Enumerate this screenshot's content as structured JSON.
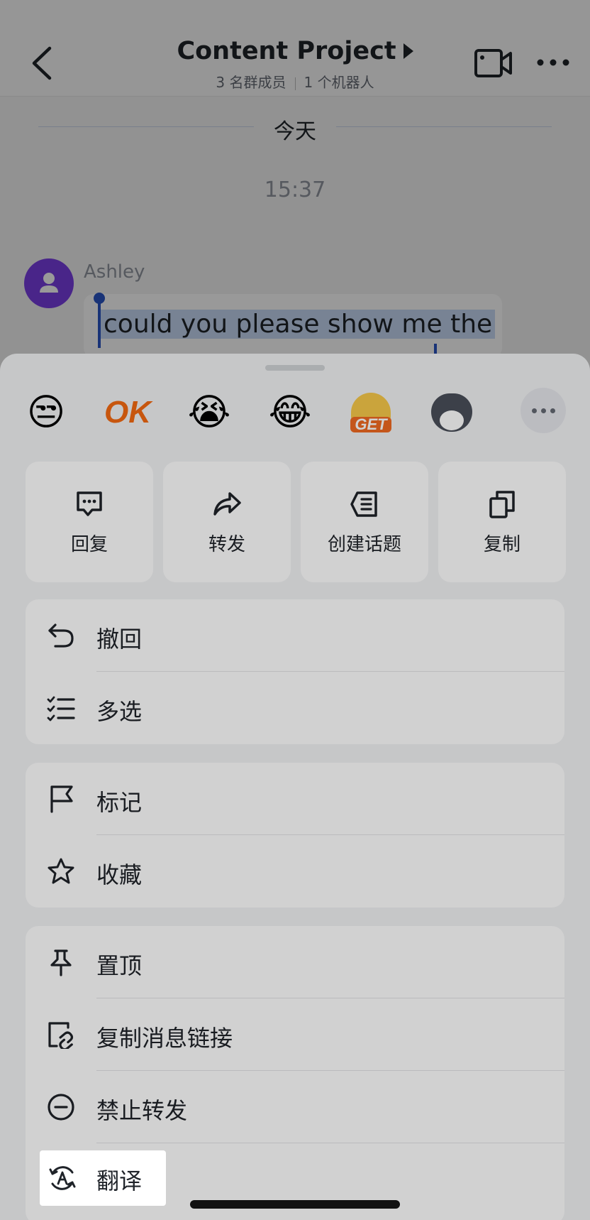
{
  "header": {
    "title": "Content Project",
    "members": "3 名群成员",
    "bots": "1 个机器人"
  },
  "chat": {
    "date_divider": "今天",
    "time": "15:37",
    "sender": "Ashley",
    "message": "could you please show me the"
  },
  "reactions": [
    {
      "icon": "unamused-face-icon",
      "glyph": "😒"
    },
    {
      "icon": "ok-sticker-icon",
      "text": "OK"
    },
    {
      "icon": "crying-laughing-face-icon",
      "glyph": "😭"
    },
    {
      "icon": "tears-of-joy-face-icon",
      "glyph": "😂"
    },
    {
      "icon": "get-sticker-icon",
      "text": "GET"
    },
    {
      "icon": "husky-dog-icon"
    }
  ],
  "quick_actions": [
    {
      "label": "回复",
      "icon": "reply-icon"
    },
    {
      "label": "转发",
      "icon": "forward-icon"
    },
    {
      "label": "创建话题",
      "icon": "create-topic-icon"
    },
    {
      "label": "复制",
      "icon": "copy-icon"
    }
  ],
  "menu_groups": [
    [
      {
        "label": "撤回",
        "icon": "undo-icon"
      },
      {
        "label": "多选",
        "icon": "multi-select-icon"
      }
    ],
    [
      {
        "label": "标记",
        "icon": "flag-icon"
      },
      {
        "label": "收藏",
        "icon": "star-icon"
      }
    ],
    [
      {
        "label": "置顶",
        "icon": "pin-icon"
      },
      {
        "label": "复制消息链接",
        "icon": "link-icon"
      },
      {
        "label": "禁止转发",
        "icon": "minus-circle-icon"
      },
      {
        "label": "翻译",
        "icon": "translate-icon"
      }
    ]
  ]
}
